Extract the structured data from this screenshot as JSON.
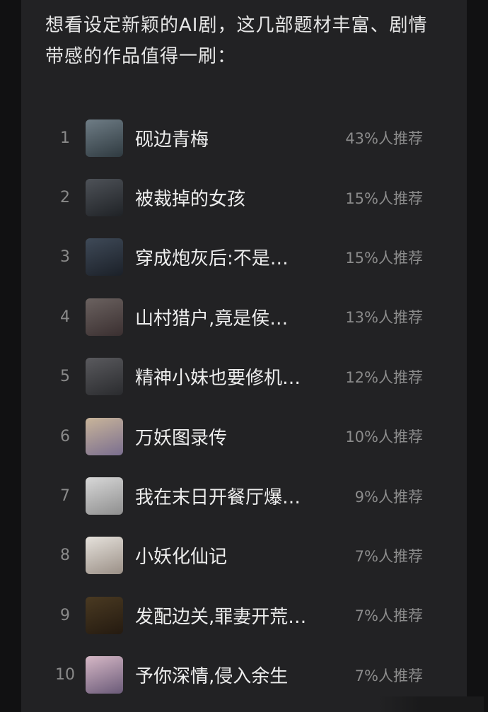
{
  "intro": "想看设定新颖的AI剧，这几部题材丰富、剧情带感的作品值得一刷：",
  "items": [
    {
      "rank": "1",
      "title": "砚边青梅",
      "pct": "43%人推荐",
      "thumb": [
        "#6f7d86",
        "#2f3a40"
      ]
    },
    {
      "rank": "2",
      "title": "被裁掉的女孩",
      "pct": "15%人推荐",
      "thumb": [
        "#4e5258",
        "#1f2226"
      ]
    },
    {
      "rank": "3",
      "title": "穿成炮灰后:不是…",
      "pct": "15%人推荐",
      "thumb": [
        "#3f4a58",
        "#1b2028"
      ]
    },
    {
      "rank": "4",
      "title": "山村猎户,竟是侯…",
      "pct": "13%人推荐",
      "thumb": [
        "#6b6260",
        "#3a2f30"
      ]
    },
    {
      "rank": "5",
      "title": "精神小妹也要修机…",
      "pct": "12%人推荐",
      "thumb": [
        "#5a5a5e",
        "#2a2b2e"
      ]
    },
    {
      "rank": "6",
      "title": "万妖图录传",
      "pct": "10%人推荐",
      "thumb": [
        "#c9b59a",
        "#7a6e8f"
      ]
    },
    {
      "rank": "7",
      "title": "我在末日开餐厅爆…",
      "pct": "9%人推荐",
      "thumb": [
        "#d8d8d8",
        "#8e8e8e"
      ]
    },
    {
      "rank": "8",
      "title": "小妖化仙记",
      "pct": "7%人推荐",
      "thumb": [
        "#e6e2dc",
        "#9a8f86"
      ]
    },
    {
      "rank": "9",
      "title": "发配边关,罪妻开荒…",
      "pct": "7%人推荐",
      "thumb": [
        "#4a3a22",
        "#241a10"
      ]
    },
    {
      "rank": "10",
      "title": "予你深情,侵入余生",
      "pct": "7%人推荐",
      "thumb": [
        "#d6b8c6",
        "#6a5a78"
      ]
    }
  ]
}
